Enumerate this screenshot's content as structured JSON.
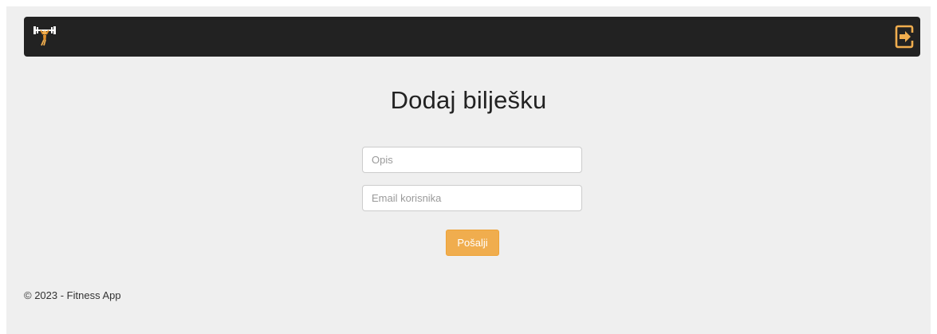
{
  "header": {
    "logo_icon": "weightlifter-icon",
    "logout_icon": "logout-icon",
    "accent_color": "#f0ad4e"
  },
  "main": {
    "title": "Dodaj bilješku",
    "description_field": {
      "placeholder": "Opis",
      "value": ""
    },
    "email_field": {
      "placeholder": "Email korisnika",
      "value": ""
    },
    "submit_label": "Pošalji"
  },
  "footer": {
    "copyright": "© 2023 - Fitness App"
  }
}
